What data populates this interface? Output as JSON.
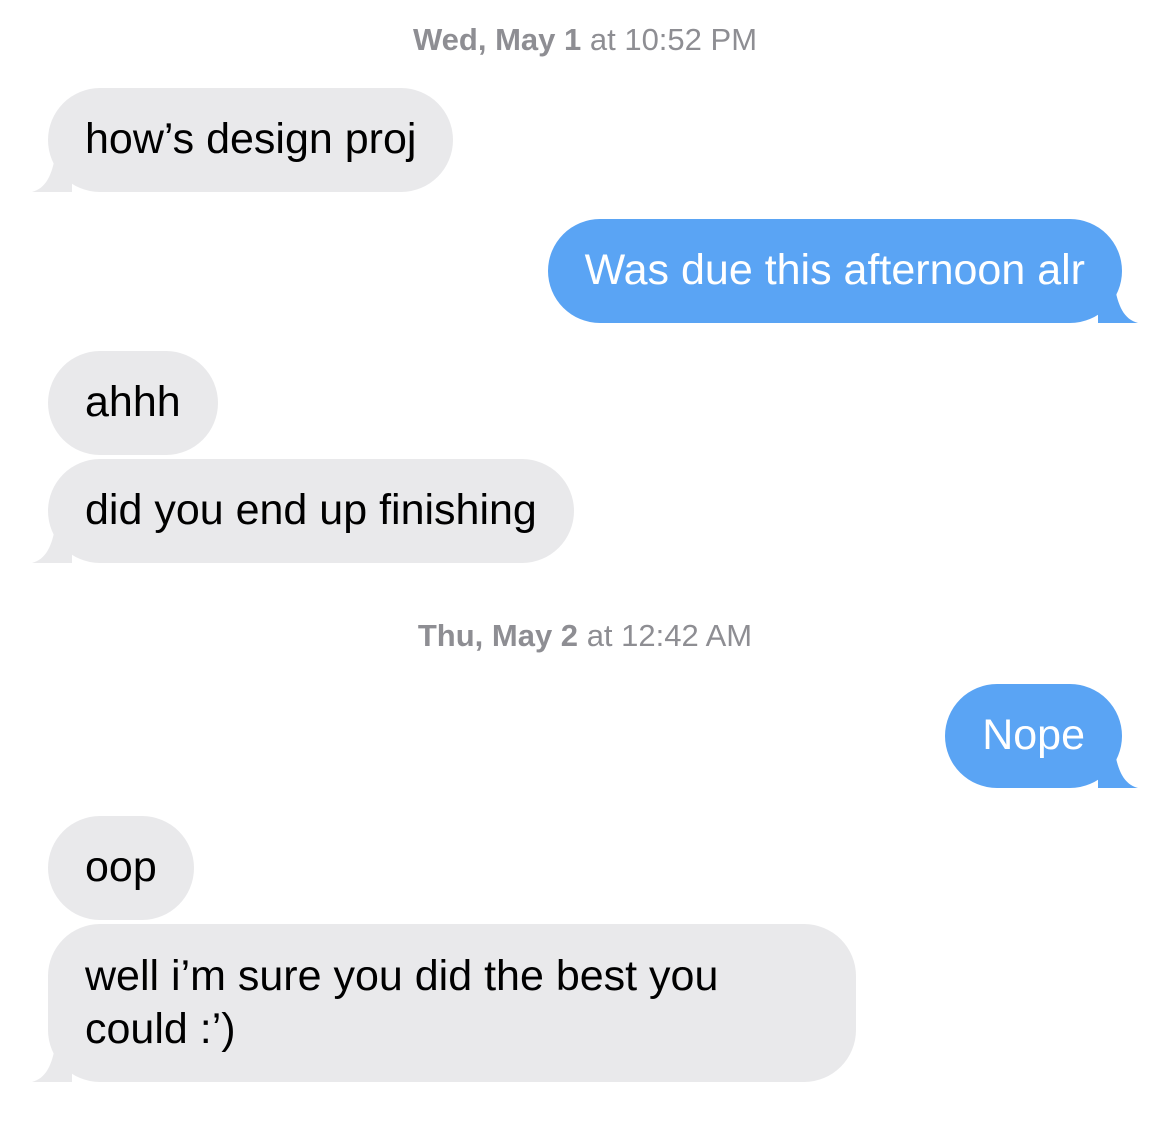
{
  "colors": {
    "incoming_bubble": "#e9e9eb",
    "outgoing_bubble": "#5aa4f4",
    "timestamp_text": "#8e8e93"
  },
  "timestamps": [
    {
      "day": "Wed, May 1",
      "time": "at 10:52 PM"
    },
    {
      "day": "Thu, May 2",
      "time": "at 12:42 AM"
    }
  ],
  "messages": [
    {
      "sender": "them",
      "text": "how’s design proj"
    },
    {
      "sender": "me",
      "text": "Was due this afternoon alr"
    },
    {
      "sender": "them",
      "text": "ahhh"
    },
    {
      "sender": "them",
      "text": "did you end up finishing"
    },
    {
      "sender": "me",
      "text": "Nope"
    },
    {
      "sender": "them",
      "text": "oop"
    },
    {
      "sender": "them",
      "text": "well i’m sure you did the best you could :’)"
    }
  ]
}
